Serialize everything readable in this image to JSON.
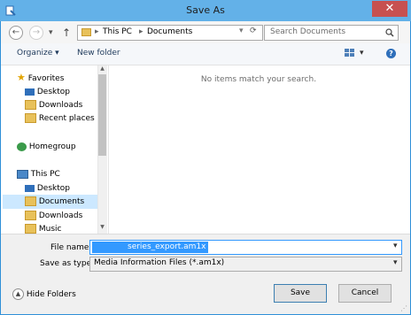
{
  "window": {
    "title": "Save As",
    "close": "✕"
  },
  "nav": {
    "back": "←",
    "forward": "→",
    "recent": "▾",
    "up": "↑",
    "refresh": "⟳",
    "breadcrumb": [
      "This PC",
      "Documents"
    ],
    "sep": "▸",
    "search_placeholder": "Search Documents"
  },
  "toolbar": {
    "organize": "Organize ▾",
    "new_folder": "New folder",
    "views": "▾",
    "help": "?"
  },
  "sidebar": {
    "favorites": {
      "label": "Favorites",
      "items": [
        {
          "label": "Desktop"
        },
        {
          "label": "Downloads"
        },
        {
          "label": "Recent places"
        }
      ]
    },
    "homegroup": {
      "label": "Homegroup"
    },
    "this_pc": {
      "label": "This PC",
      "items": [
        {
          "label": "Desktop"
        },
        {
          "label": "Documents"
        },
        {
          "label": "Downloads"
        },
        {
          "label": "Music"
        }
      ]
    }
  },
  "content": {
    "empty_message": "No items match your search."
  },
  "form": {
    "file_name_label": "File name:",
    "file_name_value": "series_export.am1x",
    "save_type_label": "Save as type:",
    "save_type_value": "Media Information Files (*.am1x)"
  },
  "footer": {
    "hide_folders": "Hide Folders",
    "save": "Save",
    "cancel": "Cancel"
  },
  "colors": {
    "accent": "#63b1e8",
    "selection": "#cce8ff",
    "close": "#c75050",
    "highlight": "#3399ff"
  }
}
